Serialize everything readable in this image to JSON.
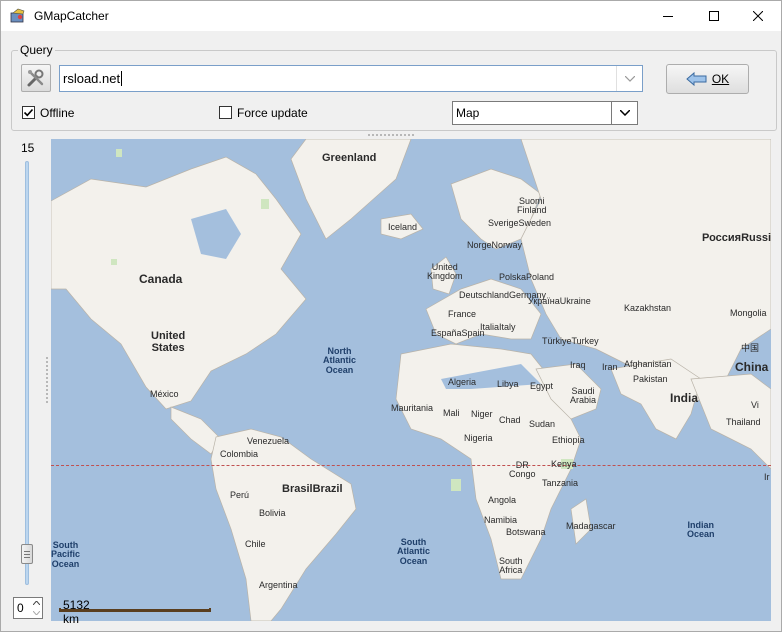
{
  "window": {
    "title": "GMapCatcher"
  },
  "query": {
    "group_label": "Query",
    "input_value": "rsload.net",
    "ok_label": "OK"
  },
  "options": {
    "offline_label": "Offline",
    "offline_checked": true,
    "force_update_label": "Force update",
    "force_update_checked": false,
    "map_type": "Map"
  },
  "zoom": {
    "level_top": "15",
    "spin_value": "0"
  },
  "scale": {
    "label": "5132 km"
  },
  "map_labels": {
    "greenland": "Greenland",
    "iceland": "Iceland",
    "suomi": "Suomi",
    "finland": "Finland",
    "sverige": "Sverige",
    "sweden": "Sweden",
    "norge": "Norge",
    "norway": "Norway",
    "rossiya": "Россия",
    "russia": "Russia",
    "canada": "Canada",
    "united_kingdom": "United Kingdom",
    "polska": "Polska",
    "poland": "Poland",
    "deutschland": "Deutschland",
    "germany": "Germany",
    "ukraina": "Україна",
    "ukraine": "Ukraine",
    "kazakhstan": "Kazakhstan",
    "mongolia": "Mongolia",
    "france": "France",
    "espana": "España",
    "spain": "Spain",
    "italia": "Italia",
    "italy": "Italy",
    "turkiye": "Türkiye",
    "turkey": "Turkey",
    "united_states": "United States",
    "north_atlantic_ocean": "North Atlantic Ocean",
    "china_zh": "中国",
    "china": "China",
    "iraq": "Iraq",
    "iran": "Iran",
    "afghanistan": "Afghanistan",
    "pakistan": "Pakistan",
    "algeria": "Algeria",
    "libya": "Libya",
    "egypt": "Egypt",
    "saudi_arabia": "Saudi Arabia",
    "mexico": "México",
    "india": "India",
    "mauritania": "Mauritania",
    "mali": "Mali",
    "niger": "Niger",
    "chad": "Chad",
    "sudan": "Sudan",
    "thailand": "Thailand",
    "venezuela": "Venezuela",
    "colombia": "Colombia",
    "nigeria": "Nigeria",
    "ethiopia": "Ethiopia",
    "dr_congo": "DR Congo",
    "kenya": "Kenya",
    "brasil": "Brasil",
    "brazil": "Brazil",
    "peru": "Perú",
    "tanzania": "Tanzania",
    "bolivia": "Bolivia",
    "angola": "Angola",
    "namibia": "Namibia",
    "botswana": "Botswana",
    "madagascar": "Madagascar",
    "south_pacific_ocean": "South Pacific Ocean",
    "chile": "Chile",
    "south_atlantic_ocean": "South Atlantic Ocean",
    "indian_ocean": "Indian Ocean",
    "south_africa": "South Africa",
    "argentina": "Argentina"
  }
}
